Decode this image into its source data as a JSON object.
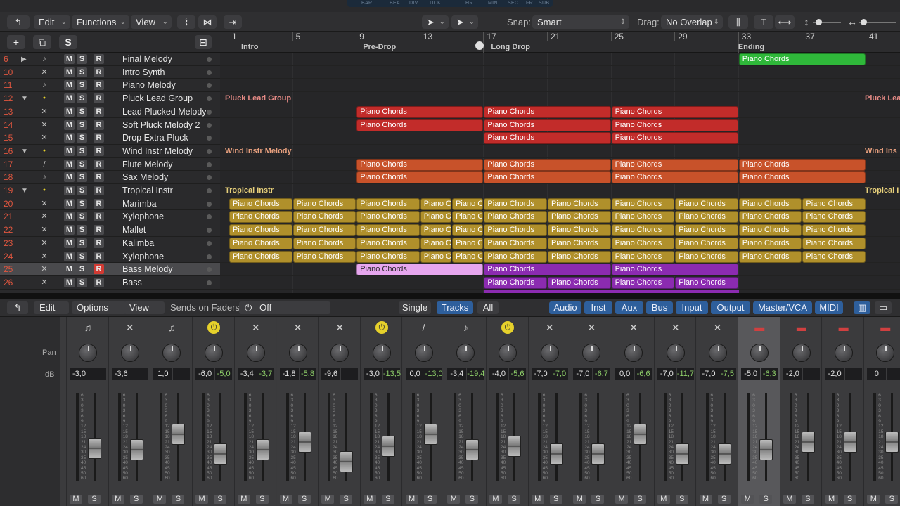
{
  "lcd": {
    "labels": [
      "BAR",
      "BEAT",
      "DIV",
      "TICK",
      "HR",
      "MIN",
      "SEC",
      "FR",
      "SUB"
    ]
  },
  "toolbar": {
    "edit": "Edit",
    "functions": "Functions",
    "view": "View",
    "snap_label": "Snap:",
    "snap_value": "Smart",
    "drag_label": "Drag:",
    "drag_value": "No Overlap"
  },
  "ruler": {
    "bars": [
      "1",
      "5",
      "9",
      "13",
      "17",
      "21",
      "25",
      "29",
      "33",
      "37",
      "41"
    ],
    "markers": [
      "Intro",
      "Pre-Drop",
      "Long Drop",
      "Ending"
    ]
  },
  "tracks": [
    {
      "num": "6",
      "name": "Final Melody",
      "disc": "▶",
      "icon": "♪"
    },
    {
      "num": "10",
      "name": "Intro Synth",
      "disc": "",
      "icon": "✕"
    },
    {
      "num": "11",
      "name": "Piano Melody",
      "disc": "",
      "icon": "♪"
    },
    {
      "num": "12",
      "name": "Pluck Lead Group",
      "disc": "▼",
      "icon": "●"
    },
    {
      "num": "13",
      "name": "Lead Plucked Melody",
      "disc": "",
      "icon": "✕"
    },
    {
      "num": "14",
      "name": "Soft Pluck Melody 2",
      "disc": "",
      "icon": "✕"
    },
    {
      "num": "15",
      "name": "Drop Extra Pluck",
      "disc": "",
      "icon": "✕"
    },
    {
      "num": "16",
      "name": "Wind Instr Melody",
      "disc": "▼",
      "icon": "●"
    },
    {
      "num": "17",
      "name": "Flute Melody",
      "disc": "",
      "icon": "/"
    },
    {
      "num": "18",
      "name": "Sax Melody",
      "disc": "",
      "icon": "♪"
    },
    {
      "num": "19",
      "name": "Tropical Instr",
      "disc": "▼",
      "icon": "●"
    },
    {
      "num": "20",
      "name": "Marimba",
      "disc": "",
      "icon": "✕"
    },
    {
      "num": "21",
      "name": "Xylophone",
      "disc": "",
      "icon": "✕"
    },
    {
      "num": "22",
      "name": "Mallet",
      "disc": "",
      "icon": "✕"
    },
    {
      "num": "23",
      "name": "Kalimba",
      "disc": "",
      "icon": "✕"
    },
    {
      "num": "24",
      "name": "Xylophone",
      "disc": "",
      "icon": "✕"
    },
    {
      "num": "25",
      "name": "Bass Melody",
      "disc": "",
      "icon": "✕"
    },
    {
      "num": "26",
      "name": "Bass",
      "disc": "",
      "icon": "✕"
    }
  ],
  "msr": {
    "m": "M",
    "s": "S",
    "r": "R"
  },
  "folders": {
    "pluck": "Pluck Lead Group",
    "pluck_short": "Pluck Lea",
    "wind": "Wind Instr Melody",
    "wind_short": "Wind Ins",
    "trop": "Tropical Instr",
    "trop_short": "Tropical I"
  },
  "region_label": "Piano Chords",
  "region_short": "Piano C",
  "mixer_toolbar": {
    "edit": "Edit",
    "options": "Options",
    "view": "View",
    "sends": "Sends on Faders:",
    "sends_value": "Off",
    "single": "Single",
    "tracks": "Tracks",
    "all": "All",
    "filters": [
      "Audio",
      "Inst",
      "Aux",
      "Bus",
      "Input",
      "Output",
      "Master/VCA",
      "MIDI"
    ]
  },
  "mixer_labels": {
    "pan": "Pan",
    "db": "dB"
  },
  "strips": [
    {
      "vol": "",
      "peak": "",
      "icon": "violin-icon"
    },
    {
      "vol": "-3,0",
      "peak": "",
      "icon": "piano-icon"
    },
    {
      "vol": "-3,6",
      "peak": "",
      "icon": "synth-icon"
    },
    {
      "vol": "1,0",
      "peak": "",
      "icon": "piano-icon"
    },
    {
      "vol": "-6,0",
      "peak": "-5,0",
      "icon": "yellow-icon"
    },
    {
      "vol": "-3,4",
      "peak": "-3,7",
      "icon": "synth-icon"
    },
    {
      "vol": "-1,8",
      "peak": "-5,8",
      "icon": "synth-icon"
    },
    {
      "vol": "-9,6",
      "peak": "",
      "icon": "synth-icon"
    },
    {
      "vol": "-3,0",
      "peak": "-13,5",
      "icon": "yellow-icon"
    },
    {
      "vol": "0,0",
      "peak": "-13,0",
      "icon": "flute-icon"
    },
    {
      "vol": "-3,4",
      "peak": "-19,4",
      "icon": "sax-icon"
    },
    {
      "vol": "-4,0",
      "peak": "-5,6",
      "icon": "yellow-icon"
    },
    {
      "vol": "-7,0",
      "peak": "-7,0",
      "icon": "synth-icon"
    },
    {
      "vol": "-7,0",
      "peak": "-6,7",
      "icon": "synth-icon"
    },
    {
      "vol": "0,0",
      "peak": "-6,6",
      "icon": "synth-icon"
    },
    {
      "vol": "-7,0",
      "peak": "-11,7",
      "icon": "synth-icon"
    },
    {
      "vol": "-7,0",
      "peak": "-7,5",
      "icon": "synth-icon"
    },
    {
      "vol": "-5,0",
      "peak": "-6,3",
      "icon": "keyboard-icon"
    },
    {
      "vol": "-2,0",
      "peak": "",
      "icon": "keyboard-icon"
    },
    {
      "vol": "-2,0",
      "peak": "",
      "icon": "keyboard-icon"
    },
    {
      "vol": "0",
      "peak": "",
      "icon": "keyboard-icon"
    }
  ],
  "scale": [
    "6",
    "3",
    "0",
    "3",
    "6",
    "9",
    "12",
    "15",
    "18",
    "21",
    "24",
    "30",
    "35",
    "40",
    "45",
    "50",
    "60"
  ],
  "colors": {
    "red": "#c22c2a",
    "orange": "#c8522a",
    "gold": "#b0902b",
    "purple": "#8b2bb0",
    "pink": "#e6a6ee",
    "green": "#2fb83a",
    "accent": "#2e5f9c"
  }
}
